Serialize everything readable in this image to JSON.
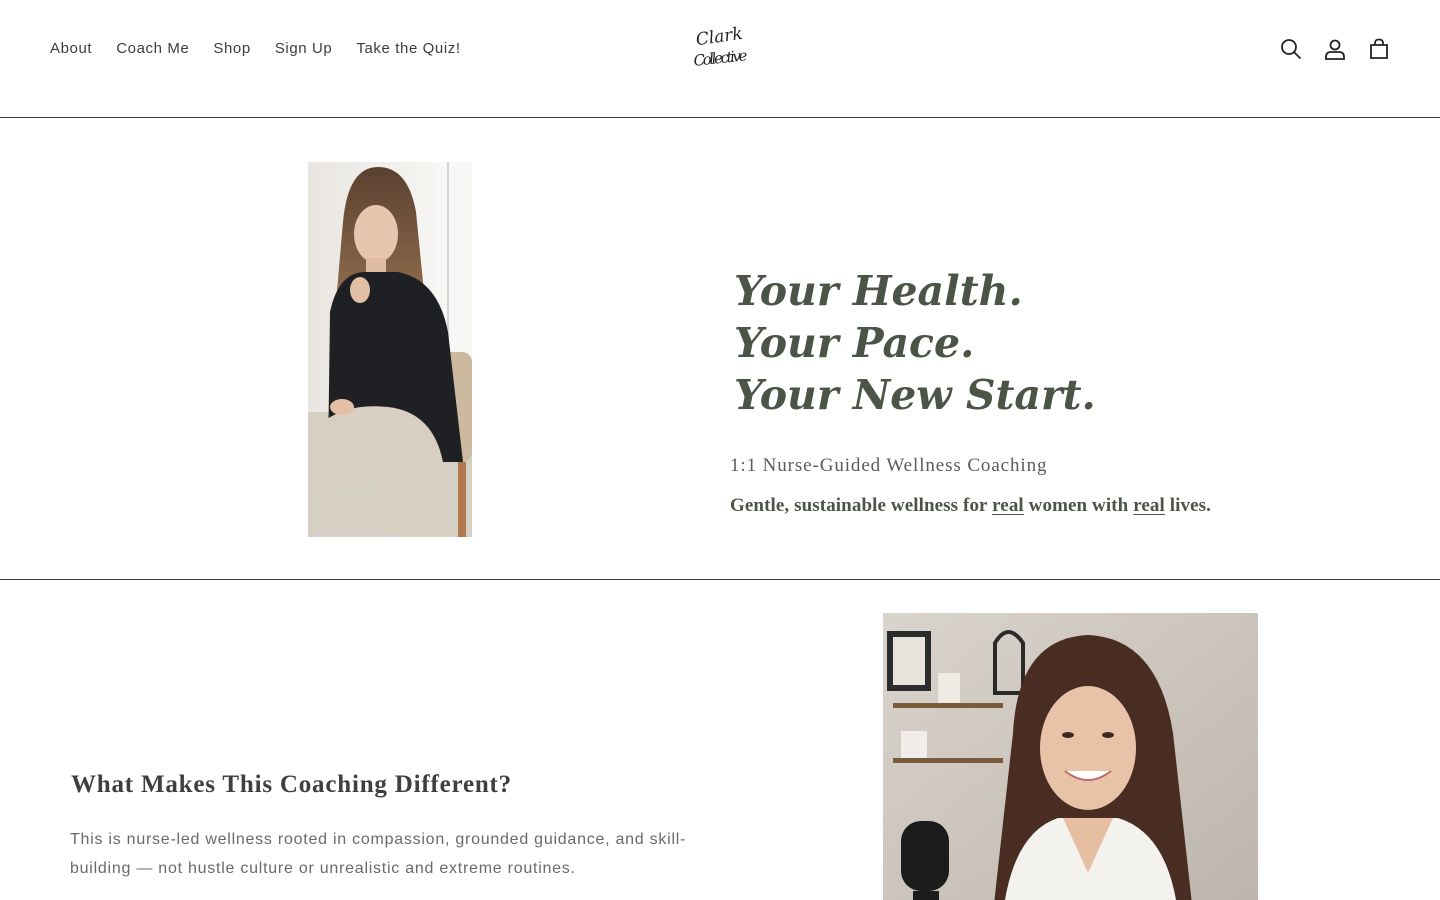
{
  "header": {
    "nav": [
      "About",
      "Coach Me",
      "Shop",
      "Sign Up",
      "Take the Quiz!"
    ],
    "logo_text": [
      "Clark",
      "Collective"
    ],
    "icons": [
      "search-icon",
      "account-icon",
      "cart-icon"
    ]
  },
  "hero": {
    "title_lines": [
      "Your Health.",
      "Your Pace.",
      "Your New Start."
    ],
    "subtitle": "1:1 Nurse-Guided Wellness Coaching",
    "tagline": {
      "part1": "Gentle, sustainable wellness for ",
      "em1": "real",
      "part2": " women with ",
      "em2": "real",
      "part3": " lives."
    },
    "image": "portrait-seated-woman-black-blouse"
  },
  "section2": {
    "heading": "What Makes This Coaching Different?",
    "body": "This is nurse-led wellness rooted in compassion, grounded guidance, and skill-building — not hustle culture or unrealistic and extreme routines.",
    "image": "portrait-smiling-woman-microphone"
  },
  "colors": {
    "accent_green": "#4b5446",
    "text_gray": "#6a6a6a",
    "divider": "#3a3a3a"
  }
}
